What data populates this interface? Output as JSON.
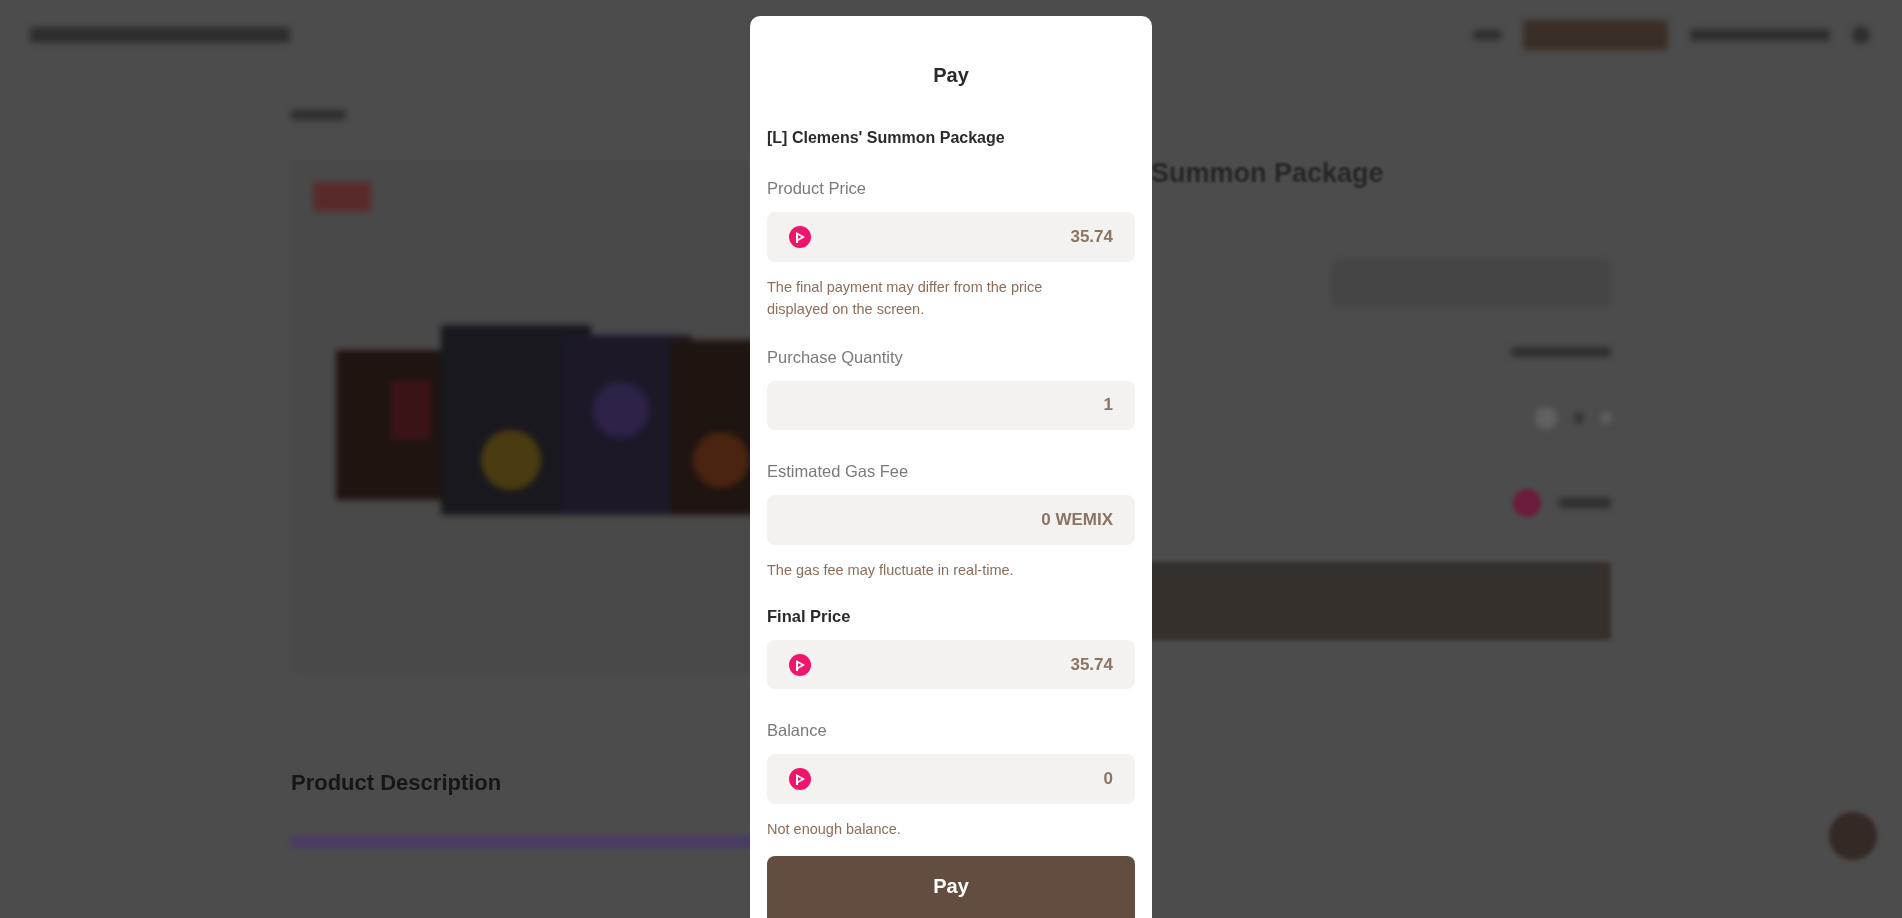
{
  "background": {
    "product_title": "Summon Package",
    "section_title": "Product Description"
  },
  "modal": {
    "title": "Pay",
    "product_name": "[L] Clemens' Summon Package",
    "fields": [
      {
        "label": "Product Price",
        "emphasis": false,
        "kind": "coin",
        "value": "35.74",
        "note": "The final payment may differ from the price displayed on the screen."
      },
      {
        "label": "Purchase Quantity",
        "emphasis": false,
        "kind": "plain",
        "value": "1"
      },
      {
        "label": "Estimated Gas Fee",
        "emphasis": false,
        "kind": "plain",
        "value": "0 WEMIX",
        "note": "The gas fee may fluctuate in real-time."
      },
      {
        "label": "Final Price",
        "emphasis": true,
        "kind": "coin",
        "value": "35.74"
      },
      {
        "label": "Balance",
        "emphasis": false,
        "kind": "coin",
        "value": "0",
        "note": "Not enough balance."
      }
    ],
    "button": "Pay"
  }
}
